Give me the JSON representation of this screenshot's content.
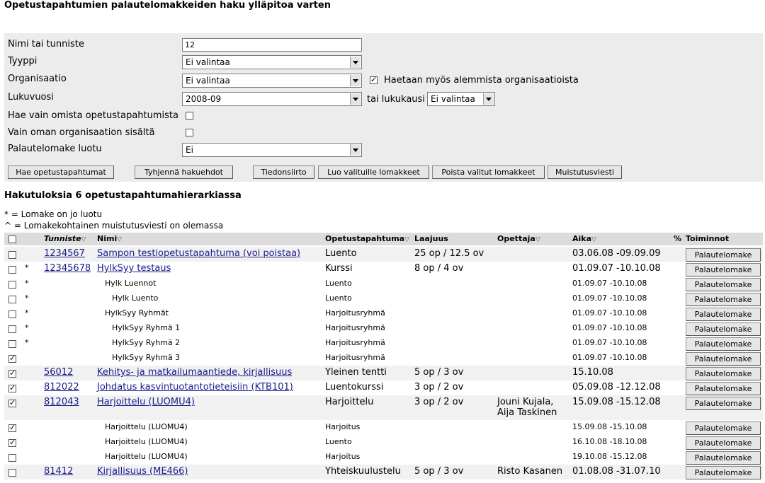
{
  "page_title": "Opetustapahtumien palautelomakkeiden haku ylläpitoa varten",
  "search": {
    "name_label": "Nimi tai tunniste",
    "name_value": "12",
    "type_label": "Tyyppi",
    "type_value": "Ei valintaa",
    "org_label": "Organisaatio",
    "org_value": "Ei valintaa",
    "sub_org_label": "Haetaan myös alemmista organisaatioista",
    "sub_org_checked": true,
    "year_label": "Lukuvuosi",
    "year_value": "2008-09",
    "month_label": "tai lukukausi",
    "month_value": "Ei valintaa",
    "own_only_label": "Hae vain omista opetustapahtumista",
    "own_org_label": "Vain oman organisaation sisältä",
    "created_label": "Palautelomake luotu",
    "created_value": "Ei"
  },
  "buttons": {
    "search": "Hae opetustapahtumat",
    "clear": "Tyhjennä hakuehdot",
    "transfer": "Tiedonsiirto",
    "create": "Luo valituille lomakkeet",
    "delete": "Poista valitut lomakkeet",
    "reminder": "Muistutusviesti"
  },
  "results": {
    "heading": "Hakutuloksia 6 opetustapahtumahierarkiassa",
    "legend_star": "* = Lomake on jo luotu",
    "legend_caret": "^ = Lomakekohtainen muistutusviesti on olemassa"
  },
  "table": {
    "columns": {
      "code": "Tunniste",
      "name": "Nimi",
      "type": "Opetustapahtuma",
      "extent": "Laajuus",
      "teacher": "Opettaja",
      "time": "Aika",
      "percent": "%",
      "actions": "Toiminnot"
    },
    "action_label": "Palautelomake",
    "rows": [
      {
        "checked": false,
        "mark": "",
        "code": "1234567",
        "name": "Sampon testiopetustapahtuma (voi poistaa)",
        "type": "Luento",
        "extent": "25 op / 12.5 ov",
        "teacher": "",
        "time": "03.06.08 -09.09.09"
      },
      {
        "checked": false,
        "mark": "*",
        "code": "12345678",
        "name": "HylkSyy testaus",
        "type": "Kurssi",
        "extent": "8 op / 4 ov",
        "teacher": "",
        "time": "01.09.07 -10.10.08"
      },
      {
        "checked": false,
        "mark": "*",
        "code": "",
        "name": "Hylk Luennot",
        "type": "Luento",
        "extent": "",
        "teacher": "",
        "time": "01.09.07 -10.10.08"
      },
      {
        "checked": false,
        "mark": "*",
        "code": "",
        "name": "Hylk Luento",
        "type": "Luento",
        "extent": "",
        "teacher": "",
        "time": "01.09.07 -10.10.08"
      },
      {
        "checked": false,
        "mark": "*",
        "code": "",
        "name": "HylkSyy Ryhmät",
        "type": "Harjoitusryhmä",
        "extent": "",
        "teacher": "",
        "time": "01.09.07 -10.10.08"
      },
      {
        "checked": false,
        "mark": "*",
        "code": "",
        "name": "HylkSyy Ryhmä 1",
        "type": "Harjoitusryhmä",
        "extent": "",
        "teacher": "",
        "time": "01.09.07 -10.10.08"
      },
      {
        "checked": false,
        "mark": "*",
        "code": "",
        "name": "HylkSyy Ryhmä 2",
        "type": "Harjoitusryhmä",
        "extent": "",
        "teacher": "",
        "time": "01.09.07 -10.10.08"
      },
      {
        "checked": true,
        "mark": "",
        "code": "",
        "name": "HylkSyy Ryhmä 3",
        "type": "Harjoitusryhmä",
        "extent": "",
        "teacher": "",
        "time": "01.09.07 -10.10.08"
      },
      {
        "checked": true,
        "mark": "",
        "code": "56012",
        "name": "Kehitys- ja matkailumaantiede, kirjallisuus",
        "type": "Yleinen tentti",
        "extent": "5 op / 3 ov",
        "teacher": "",
        "time": "15.10.08"
      },
      {
        "checked": true,
        "mark": "",
        "code": "812022",
        "name": "Johdatus kasvintuotantotieteisiin (KTB101)",
        "type": "Luentokurssi",
        "extent": "3 op / 2 ov",
        "teacher": "",
        "time": "05.09.08 -12.12.08"
      },
      {
        "checked": true,
        "mark": "",
        "code": "812043",
        "name": "Harjoittelu (LUOMU4)",
        "type": "Harjoittelu",
        "extent": "3 op / 2 ov",
        "teacher": "Jouni Kujala,",
        "teacher2": "Aija Taskinen",
        "time": "15.09.08 -15.12.08"
      },
      {
        "checked": true,
        "mark": "",
        "code": "",
        "name": "Harjoittelu (LUOMU4)",
        "type": "Harjoitus",
        "extent": "",
        "teacher": "",
        "time": "15.09.08 -15.10.08"
      },
      {
        "checked": true,
        "mark": "",
        "code": "",
        "name": "Harjoittelu (LUOMU4)",
        "type": "Luento",
        "extent": "",
        "teacher": "",
        "time": "16.10.08 -18.10.08"
      },
      {
        "checked": false,
        "mark": "",
        "code": "",
        "name": "Harjoittelu (LUOMU4)",
        "type": "Harjoitus",
        "extent": "",
        "teacher": "",
        "time": "19.10.08 -15.12.08"
      },
      {
        "checked": false,
        "mark": "",
        "code": "81412",
        "name": "Kirjallisuus (ME466)",
        "type": "Yhteiskuulustelu",
        "extent": "5 op / 3 ov",
        "teacher": "Risto Kasanen",
        "time": "01.08.08 -31.07.10"
      }
    ]
  }
}
